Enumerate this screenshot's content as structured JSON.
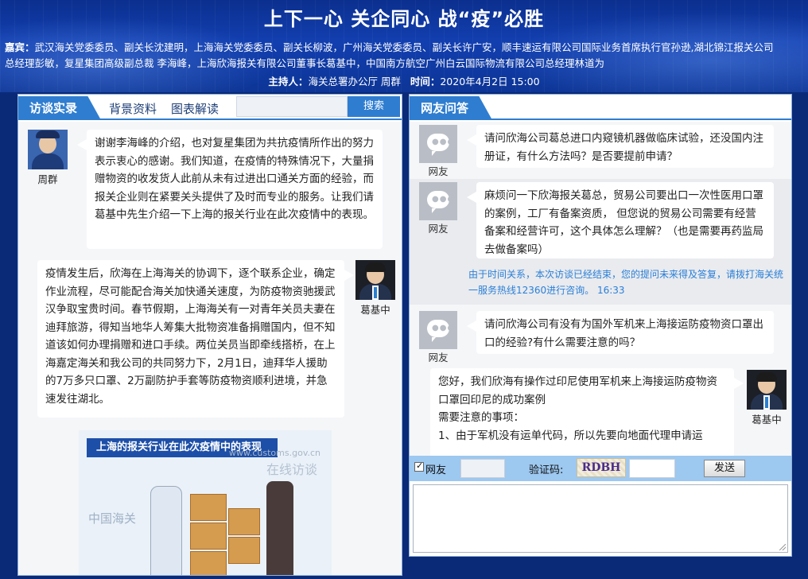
{
  "header": {
    "title": "上下一心 关企同心 战“疫”必胜",
    "guests_label": "嘉宾：",
    "guests_text": "武汉海关党委委员、副关长沈建明，上海海关党委委员、副关长柳波，广州海关党委委员、副关长许广安，顺丰速运有限公司国际业务首席执行官孙逊,湖北锦江报关公司总经理彭敏，复星集团高级副总裁 李海峰，上海欣海报关有限公司董事长葛基中，中国南方航空广州白云国际物流有限公司总经理林道为",
    "host_label": "主持人：",
    "host_value": "海关总署办公厅 周群",
    "time_label": "时间：",
    "time_value": "2020年4月2日 15:00"
  },
  "left_panel": {
    "tab_active": "访谈实录",
    "tabs": [
      "背景资料",
      "图表解读"
    ],
    "search_button": "搜索",
    "messages": [
      {
        "speaker": "周群",
        "text": "谢谢李海峰的介绍，也对复星集团为共抗疫情所作出的努力表示衷心的感谢。我们知道，在疫情的特殊情况下，大量捐赠物资的收发货人此前从未有过进出口通关方面的经验，而报关企业则在紧要关头提供了及时而专业的服务。让我们请葛基中先生介绍一下上海的报关行业在此次疫情中的表现。"
      },
      {
        "speaker": "葛基中",
        "text": "疫情发生后，欣海在上海海关的协调下，逐个联系企业，确定作业流程，尽可能配合海关加快通关速度，为防疫物资驰援武汉争取宝贵时间。春节假期，上海海关有一对青年关员夫妻在迪拜旅游，得知当地华人筹集大批物资准备捐赠国内，但不知道该如何办理捐赠和进口手续。两位关员当即牵线搭桥，在上海嘉定海关和我公司的共同努力下，2月1日，迪拜华人援助的7万多只口罩、2万副防护手套等防疫物资顺利进境，并急速发往湖北。"
      }
    ],
    "infographic": {
      "banner": "上海的报关行业在此次疫情中的表现",
      "watermark_url": "www.customs.gov.cn",
      "watermark_text": "在线访谈",
      "logo_text": "中国海关"
    }
  },
  "right_panel": {
    "tab_active": "网友问答",
    "qa": [
      {
        "asker": "网友",
        "text": "请问欣海公司葛总进口内窥镜机器做临床试验，还没国内注册证，有什么方法吗？是否要提前申请？"
      },
      {
        "asker": "网友",
        "text": "麻烦问一下欣海报关葛总，贸易公司要出口一次性医用口罩的案例，工厂有备案资质， 但您说的贸易公司需要有经营备案和经营许可，这个具体怎么理解？（也是需要再药监局去做备案吗）",
        "reply_note": "由于时间关系，本次访谈已经结束，您的提问未来得及答复，请拨打海关统一服务热线12360进行咨询。 16:33"
      },
      {
        "asker": "网友",
        "text": "请问欣海公司有没有为国外军机来上海接运防疫物资口罩出口的经验?有什么需要注意的吗？"
      }
    ],
    "answer": {
      "speaker": "葛基中",
      "text_lines": [
        "您好，我们欣海有操作过印尼使用军机来上海接运防疫物资口罩回印尼的成功案例",
        "需要注意的事项：",
        "1、由于军机没有运单代码，所以先要向地面代理申请运"
      ]
    },
    "sendbar": {
      "checkbox_label": "网友",
      "captcha_label": "验证码:",
      "captcha_value": "RDBH",
      "send_button": "发送"
    }
  }
}
